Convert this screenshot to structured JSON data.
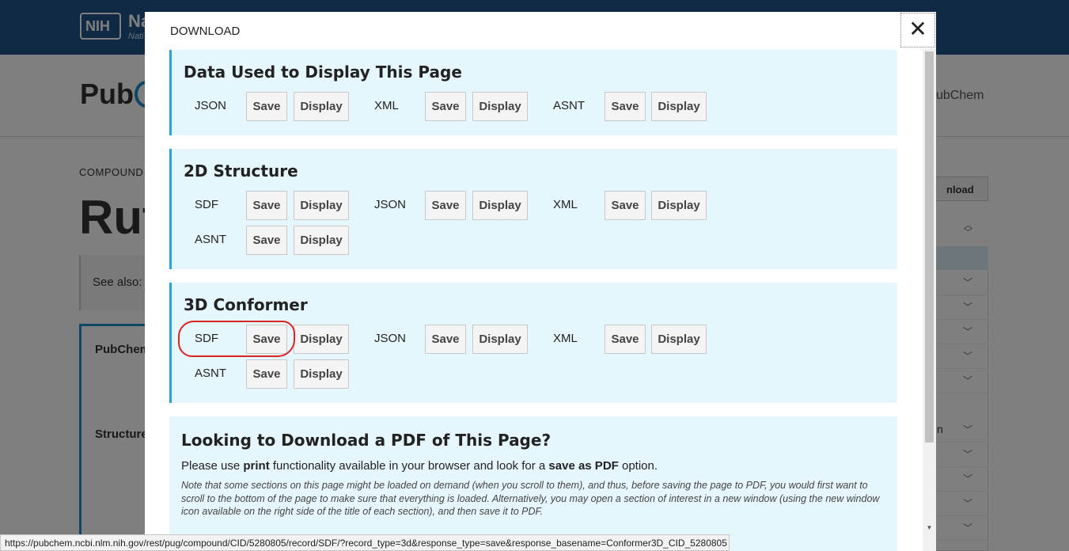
{
  "background": {
    "nih_logo": "NIH",
    "nih_name": "Na",
    "nih_sub": "Nati",
    "pubchem_logo": "Pub",
    "about_link": "ubChem",
    "breadcrumb": "COMPOUND",
    "compound_title": "Rut",
    "see_also": "See also:",
    "download_button": "nload",
    "info_header": "PubChem",
    "info_structure": "Structure",
    "toc_partial": "n"
  },
  "modal": {
    "title": "DOWNLOAD",
    "close_glyph": "✕",
    "sections": [
      {
        "title": "Data Used to Display This Page",
        "rows": [
          [
            {
              "format": "JSON",
              "save": "Save",
              "display": "Display"
            },
            {
              "format": "XML",
              "save": "Save",
              "display": "Display"
            },
            {
              "format": "ASNT",
              "save": "Save",
              "display": "Display"
            }
          ]
        ]
      },
      {
        "title": "2D Structure",
        "rows": [
          [
            {
              "format": "SDF",
              "save": "Save",
              "display": "Display"
            },
            {
              "format": "JSON",
              "save": "Save",
              "display": "Display"
            },
            {
              "format": "XML",
              "save": "Save",
              "display": "Display"
            }
          ],
          [
            {
              "format": "ASNT",
              "save": "Save",
              "display": "Display"
            }
          ]
        ]
      },
      {
        "title": "3D Conformer",
        "rows": [
          [
            {
              "format": "SDF",
              "save": "Save",
              "display": "Display"
            },
            {
              "format": "JSON",
              "save": "Save",
              "display": "Display"
            },
            {
              "format": "XML",
              "save": "Save",
              "display": "Display"
            }
          ],
          [
            {
              "format": "ASNT",
              "save": "Save",
              "display": "Display"
            }
          ]
        ]
      }
    ],
    "pdf": {
      "title": "Looking to Download a PDF of This Page?",
      "line_prefix": "Please use ",
      "line_bold1": "print",
      "line_middle": " functionality available in your browser and look for a ",
      "line_bold2": "save as PDF",
      "line_suffix": " option.",
      "note": "Note that some sections on this page might be loaded on demand (when you scroll to them), and thus, before saving the page to PDF, you would first want to scroll to the bottom of the page to make sure that everything is loaded. Alternatively, you may open a section of interest in a new window (using the new window icon available on the right side of the title of each section), and then save it to PDF."
    }
  },
  "status_bar": {
    "url": "https://pubchem.ncbi.nlm.nih.gov/rest/pug/compound/CID/5280805/record/SDF/?record_type=3d&response_type=save&response_basename=Conformer3D_CID_5280805"
  },
  "colors": {
    "nih_blue": "#20558a",
    "section_bg": "#e6f6fd",
    "section_accent": "#27a5d9",
    "highlight_red": "#d92424"
  }
}
